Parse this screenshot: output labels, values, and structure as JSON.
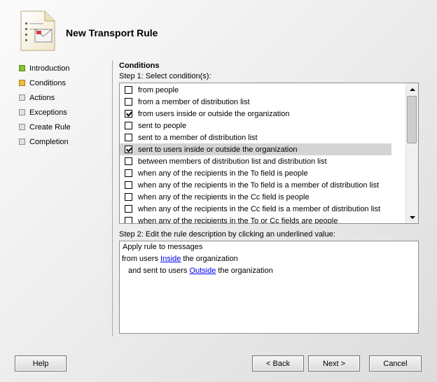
{
  "header": {
    "title": "New Transport Rule",
    "icon": "document-envelope-icon"
  },
  "nav": {
    "items": [
      {
        "label": "Introduction",
        "state": "done"
      },
      {
        "label": "Conditions",
        "state": "current"
      },
      {
        "label": "Actions",
        "state": "pending"
      },
      {
        "label": "Exceptions",
        "state": "pending"
      },
      {
        "label": "Create Rule",
        "state": "pending"
      },
      {
        "label": "Completion",
        "state": "pending"
      }
    ]
  },
  "main": {
    "section_title": "Conditions",
    "step1_label": "Step 1: Select condition(s):",
    "conditions": [
      {
        "label": "from people",
        "checked": false
      },
      {
        "label": "from a member of distribution list",
        "checked": false
      },
      {
        "label": "from users inside or outside the organization",
        "checked": true
      },
      {
        "label": "sent to people",
        "checked": false
      },
      {
        "label": "sent to a member of distribution list",
        "checked": false
      },
      {
        "label": "sent to users inside or outside the organization",
        "checked": true,
        "selected": true
      },
      {
        "label": "between members of distribution list and distribution list",
        "checked": false
      },
      {
        "label": "when any of the recipients in the To field is people",
        "checked": false
      },
      {
        "label": "when any of the recipients in the To field is a member of distribution list",
        "checked": false
      },
      {
        "label": "when any of the recipients in the Cc field is people",
        "checked": false
      },
      {
        "label": "when any of the recipients in the Cc field is a member of distribution list",
        "checked": false
      },
      {
        "label": "when any of the recipients in the To or Cc fields are people",
        "checked": false
      }
    ],
    "step2_label": "Step 2: Edit the rule description by clicking an underlined value:",
    "description": {
      "line1": "Apply rule to messages",
      "line2_pre": "from users ",
      "line2_link": "Inside",
      "line2_post": " the organization",
      "line3_pre": "and sent to users ",
      "line3_link": "Outside",
      "line3_post": " the organization"
    }
  },
  "buttons": {
    "help": "Help",
    "back": "< Back",
    "next": "Next >",
    "cancel": "Cancel"
  }
}
